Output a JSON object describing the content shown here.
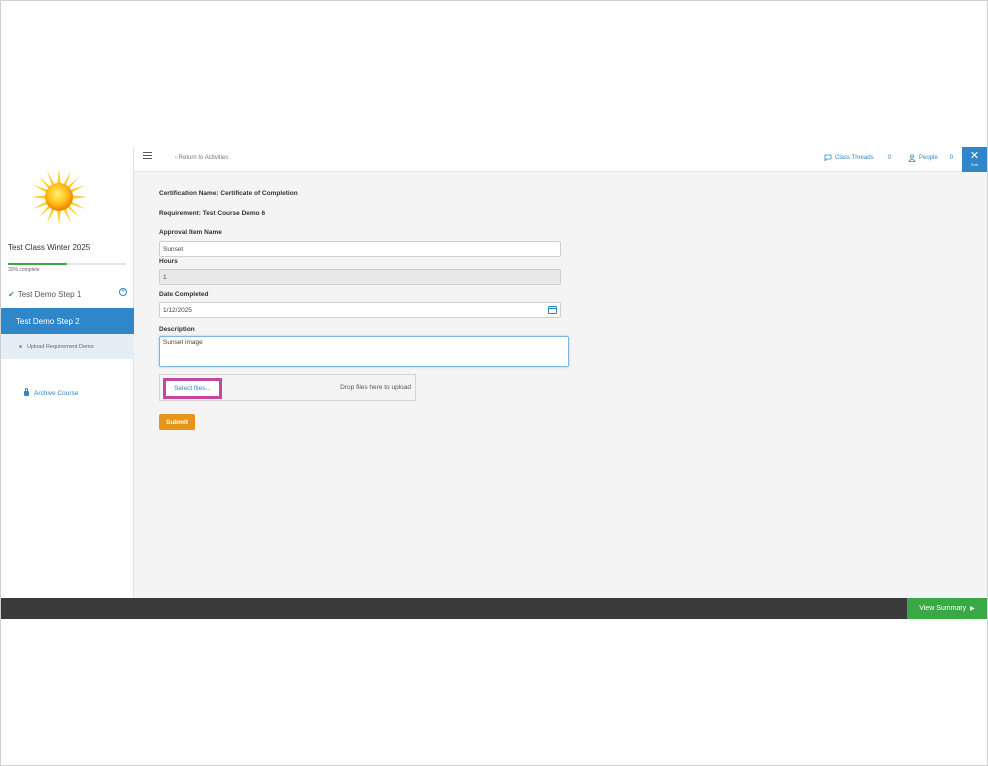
{
  "sidebar": {
    "course_title": "Test Class Winter 2025",
    "progress_text": "30% complete",
    "progress_value": 0.5,
    "steps": [
      {
        "label": "Test Demo Step 1",
        "status": "completed"
      },
      {
        "label": "Test Demo Step 2",
        "status": "active"
      }
    ],
    "substeps": [
      {
        "label": "Upload Requirement Demo"
      }
    ],
    "archive_label": "Archive Course"
  },
  "topbar": {
    "back_label": "Return to Activities",
    "threads_label": "Class Threads",
    "threads_count": "0",
    "people_label": "People",
    "people_count": "0",
    "exit_label": "Exit"
  },
  "form": {
    "certification": "Certification Name: Certificate of Completion",
    "requirement": "Requirement: Test Course Demo 6",
    "approval_label": "Approval Item Name",
    "approval_value": "Sunset",
    "hours_label": "Hours",
    "hours_value": "1",
    "date_label": "Date Completed",
    "date_value": "1/12/2025",
    "description_label": "Description",
    "description_value": "Sunset image",
    "select_files": "Select files...",
    "drop_text": "Drop files here to upload",
    "submit_label": "Submit"
  },
  "footer": {
    "view_summary": "View Summary"
  },
  "colors": {
    "accent": "#2f86c8",
    "success": "#3aa845",
    "submit": "#e8941a",
    "highlight": "#c0499f",
    "footer_bg": "#3a3a3a"
  }
}
